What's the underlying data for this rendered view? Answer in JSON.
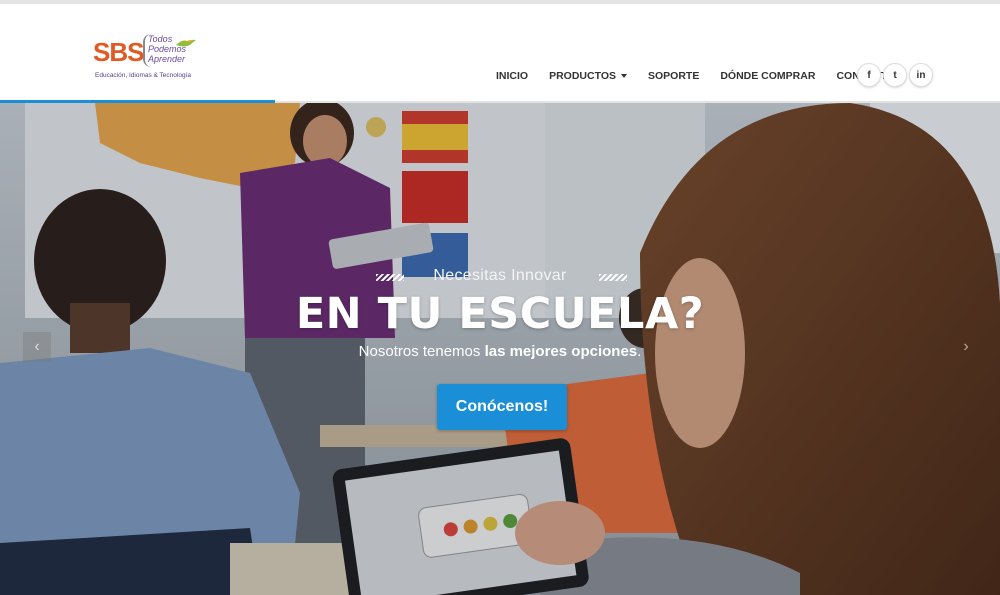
{
  "brand": {
    "name": "SBS",
    "slogan_lines": [
      "Todos",
      "Podemos",
      "Aprender"
    ],
    "tagline": "Educación, Idiomas & Tecnología"
  },
  "nav": {
    "items": [
      {
        "label": "INICIO"
      },
      {
        "label": "PRODUCTOS",
        "has_dropdown": true
      },
      {
        "label": "SOPORTE"
      },
      {
        "label": "DÓNDE COMPRAR"
      },
      {
        "label": "CONTACTO"
      }
    ]
  },
  "social": [
    {
      "glyph": "f",
      "icon": "facebook-icon"
    },
    {
      "glyph": "t",
      "icon": "twitter-icon"
    },
    {
      "glyph": "in",
      "icon": "linkedin-icon"
    }
  ],
  "hero": {
    "pre_title": "Necesitas Innovar",
    "title": "EN TU ESCUELA?",
    "subtitle_lead": "Nosotros tenemos ",
    "subtitle_bold": "las mejores opciones",
    "subtitle_end": ".",
    "cta_label": "Conócenos!",
    "prev_arrow": "‹",
    "next_arrow": "›"
  },
  "colors": {
    "accent": "#1a8fd7",
    "brand_orange": "#e05a26",
    "brand_purple": "#6b4ba0"
  }
}
